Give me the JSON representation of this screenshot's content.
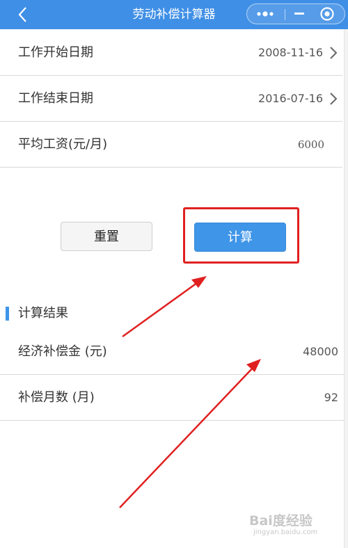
{
  "app": {
    "title": "劳动补偿计算器"
  },
  "form": {
    "rows": [
      {
        "label": "工作开始日期",
        "value": "2008-11-16"
      },
      {
        "label": "工作结束日期",
        "value": "2016-07-16"
      },
      {
        "label": "平均工资(元/月)",
        "value": "6000"
      }
    ]
  },
  "buttons": {
    "reset": "重置",
    "calculate": "计算"
  },
  "result": {
    "title": "计算结果",
    "rows": [
      {
        "label": "经济补偿金 (元)",
        "value": "48000"
      },
      {
        "label": "补偿月数 (月)",
        "value": "92"
      }
    ]
  },
  "watermark": {
    "brand": "Bai度经验",
    "url": "jingyan.baidu.com"
  },
  "colors": {
    "nav": "#3f8fe6",
    "primary_button": "#3f95e8",
    "annotation": "#e02020"
  },
  "icons": {
    "back": "chevron-left-icon",
    "more": "more-dots-icon",
    "minimize": "minimize-icon",
    "close": "target-close-icon",
    "row_arrow": "chevron-right-icon"
  }
}
